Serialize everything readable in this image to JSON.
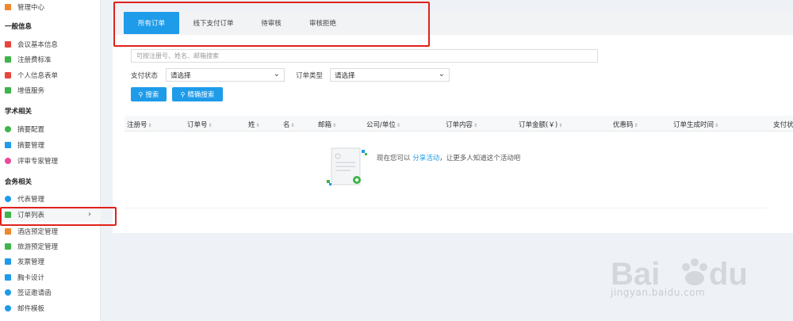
{
  "sidebar": {
    "top_item": {
      "label": "管理中心",
      "icon": "grid-icon",
      "color": "#f0872b"
    },
    "sections": [
      {
        "title": "一般信息"
      },
      {
        "title": "学术相关"
      },
      {
        "title": "会务相关"
      }
    ],
    "items": [
      {
        "label": "会议基本信息",
        "icon": "doc-icon",
        "color": "#e8453c"
      },
      {
        "label": "注册费标准",
        "icon": "tag-icon",
        "color": "#3db54a"
      },
      {
        "label": "个人信息表单",
        "icon": "form-icon",
        "color": "#e8453c"
      },
      {
        "label": "增值服务",
        "icon": "cart-icon",
        "color": "#3db54a"
      },
      {
        "label": "摘要配置",
        "icon": "gear-icon",
        "color": "#3db54a"
      },
      {
        "label": "摘要管理",
        "icon": "doc-icon",
        "color": "#1e9be9"
      },
      {
        "label": "评审专家管理",
        "icon": "user-icon",
        "color": "#e84a9a"
      },
      {
        "label": "代表管理",
        "icon": "users-icon",
        "color": "#1e9be9"
      },
      {
        "label": "订单列表",
        "icon": "clipboard-icon",
        "color": "#3db54a"
      },
      {
        "label": "酒店预定管理",
        "icon": "hotel-icon",
        "color": "#f0872b"
      },
      {
        "label": "旅游预定管理",
        "icon": "flag-icon",
        "color": "#3db54a"
      },
      {
        "label": "发票管理",
        "icon": "receipt-icon",
        "color": "#1e9be9"
      },
      {
        "label": "胸卡设计",
        "icon": "card-icon",
        "color": "#1e9be9"
      },
      {
        "label": "签证邀请函",
        "icon": "mail-icon",
        "color": "#1e9be9"
      },
      {
        "label": "邮件模板",
        "icon": "mail-icon",
        "color": "#1e9be9"
      }
    ],
    "active_chevron": "›"
  },
  "tabs": [
    {
      "label": "所有订单"
    },
    {
      "label": "线下支付订单"
    },
    {
      "label": "待审核"
    },
    {
      "label": "审核拒绝"
    }
  ],
  "filters": {
    "search_placeholder": "可按注册号、姓名、邮箱搜索",
    "pay_status_label": "支付状态",
    "pay_status_value": "请选择",
    "order_type_label": "订单类型",
    "order_type_value": "请选择",
    "search_btn": "搜索",
    "exact_search_btn": "精确搜索"
  },
  "table": {
    "columns": [
      "注册号",
      "订单号",
      "姓",
      "名",
      "邮箱",
      "公司/单位",
      "订单内容",
      "订单金额(￥)",
      "优惠码",
      "订单生成时间",
      "支付状"
    ]
  },
  "empty": {
    "prefix": "现在您可以",
    "link": "分享活动",
    "suffix": "，让更多人知道这个活动吧"
  },
  "watermark": {
    "text": "jingyan.baidu.com"
  },
  "colors": {
    "accent": "#1e9be9",
    "highlight": "#e0211c"
  }
}
